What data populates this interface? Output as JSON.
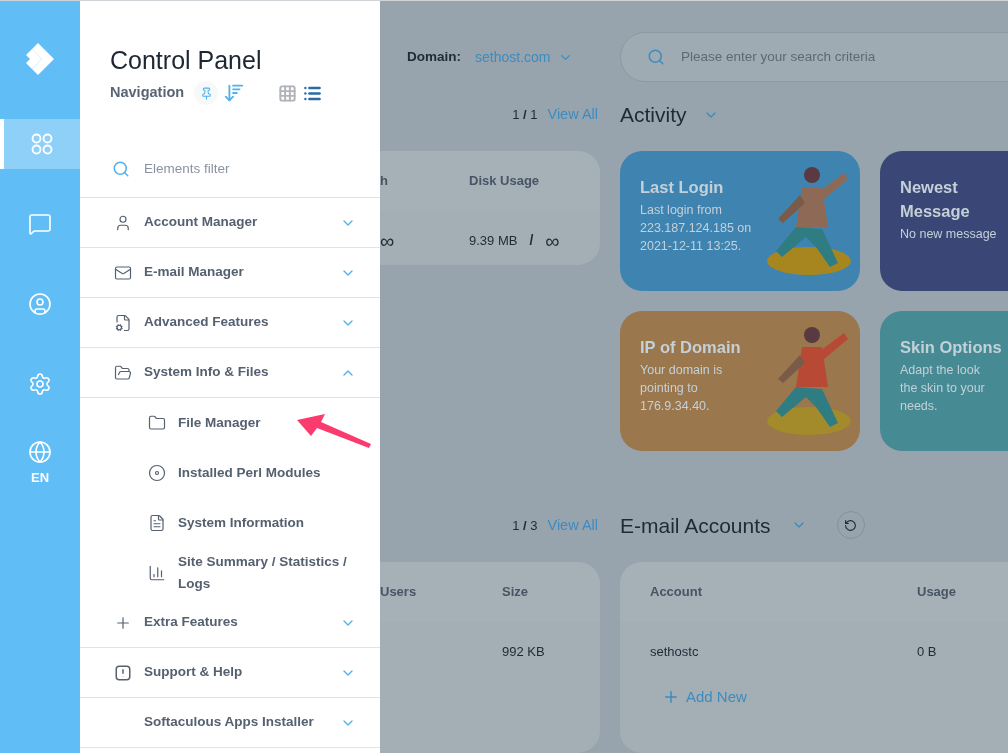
{
  "rail": {
    "items": [
      {
        "kind": "apps",
        "selected": true
      },
      {
        "kind": "messages",
        "selected": false
      },
      {
        "kind": "account",
        "selected": false
      },
      {
        "kind": "settings",
        "selected": false
      },
      {
        "kind": "language",
        "selected": false,
        "label": "EN"
      }
    ]
  },
  "nav": {
    "title": "Control Panel",
    "subtitle": "Navigation",
    "views": [
      {
        "kind": "grid",
        "selected": false
      },
      {
        "kind": "list",
        "selected": true
      }
    ],
    "filter": {
      "placeholder": "Elements filter"
    },
    "items": [
      {
        "kind": "account",
        "label": "Account Manager",
        "expanded": false
      },
      {
        "kind": "email",
        "label": "E-mail Manager",
        "expanded": false
      },
      {
        "kind": "advanced",
        "label": "Advanced Features",
        "expanded": false
      },
      {
        "kind": "files",
        "label": "System Info & Files",
        "expanded": true,
        "children": [
          {
            "kind": "folder",
            "label": "File Manager"
          },
          {
            "kind": "perl",
            "label": "Installed Perl Modules"
          },
          {
            "kind": "info",
            "label": "System Information"
          },
          {
            "kind": "stats",
            "label": "Site Summary / Statistics / Logs"
          }
        ]
      },
      {
        "kind": "extra",
        "label": "Extra Features",
        "expanded": false
      },
      {
        "kind": "support",
        "label": "Support & Help",
        "expanded": false
      },
      {
        "kind": "apps",
        "label": "Softaculous Apps Installer",
        "expanded": false
      }
    ]
  },
  "main": {
    "domain": {
      "label": "Domain:",
      "value": "sethost.com"
    },
    "search": {
      "placeholder": "Please enter your search criteria"
    },
    "top": {
      "pager": {
        "current": "1",
        "separator": "/",
        "total": "1",
        "link": "View All"
      },
      "table": {
        "columns": [
          "h",
          "Disk Usage"
        ],
        "row": [
          "∞",
          "9.39 MB",
          "/",
          "∞"
        ]
      }
    },
    "activity": {
      "title": "Activity",
      "cards": [
        {
          "title": "Last Login",
          "lines": [
            "Last login from",
            "223.187.124.185 on",
            "2021-12-11 13:25."
          ],
          "color": "#3f84b1",
          "kind": "illustrated"
        },
        {
          "title": "Newest Message",
          "lines": [
            "No new message"
          ],
          "color": "#3a4675",
          "kind": "plain"
        },
        {
          "title": "IP of Domain",
          "lines": [
            "Your domain is",
            "pointing to",
            "176.9.34.40."
          ],
          "color": "#9a774c",
          "kind": "illustrated"
        },
        {
          "title": "Skin Options",
          "lines": [
            "Adapt the look",
            "the skin to your",
            "needs."
          ],
          "color": "#468a94",
          "kind": "plain"
        }
      ]
    },
    "bottom": {
      "pager": {
        "current": "1",
        "separator": "/",
        "total": "3",
        "link": "View All"
      },
      "table": {
        "columns": [
          "Users",
          "Size"
        ],
        "row": [
          "992 KB"
        ]
      }
    },
    "email": {
      "title": "E-mail Accounts",
      "columns": [
        "Account",
        "Usage"
      ],
      "rows": [
        [
          "sethostc",
          "0 B"
        ]
      ],
      "add": "Add New"
    }
  }
}
